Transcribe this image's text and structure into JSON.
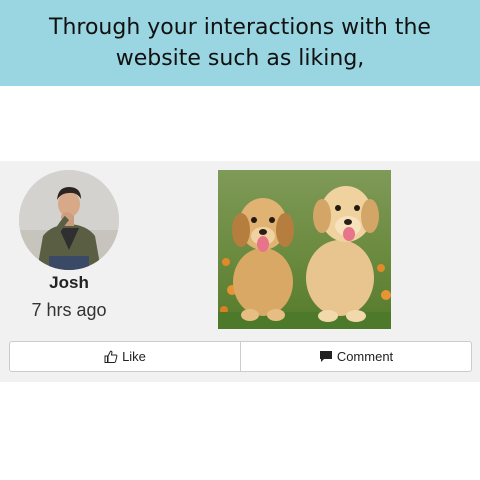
{
  "banner": {
    "text": "Through your interactions with the website such as liking,"
  },
  "post": {
    "author": "Josh",
    "timestamp": "7 hrs ago",
    "image": "two golden retriever puppies sitting on grass"
  },
  "actions": {
    "like_label": "Like",
    "like_icon": "thumbs-up-icon",
    "comment_label": "Comment",
    "comment_icon": "comment-icon"
  },
  "colors": {
    "banner_bg": "#99d6e1",
    "card_bg": "#f1f1f1"
  }
}
